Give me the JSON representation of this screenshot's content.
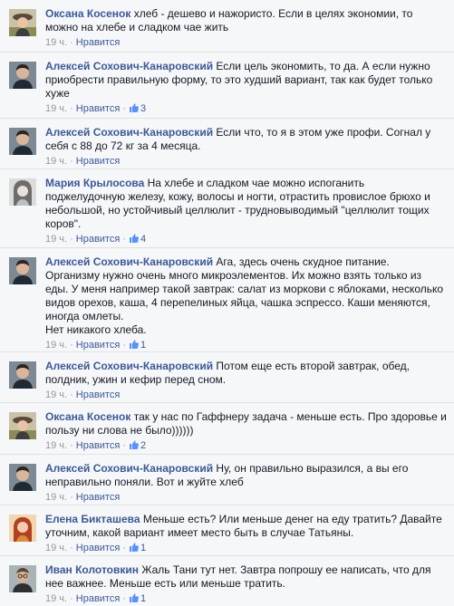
{
  "comments": [
    {
      "author": "Оксана Косенок",
      "avatar": "woman-hat",
      "text": "хлеб - дешево и нажористо. Если в целях экономии, то можно на хлебе и сладком чае жить",
      "time": "19 ч.",
      "like_label": "Нравится",
      "likes": ""
    },
    {
      "author": "Алексей Сохович-Канаровский",
      "avatar": "man-dark",
      "text": "Если цель экономить, то да. А если нужно приобрести правильную форму, то это худший вариант, так как будет только хуже",
      "time": "19 ч.",
      "like_label": "Нравится",
      "likes": "3"
    },
    {
      "author": "Алексей Сохович-Канаровский",
      "avatar": "man-dark",
      "text": "Если что, то я в этом уже профи. Согнал у себя с 88 до 72 кг за 4 месяца.",
      "time": "19 ч.",
      "like_label": "Нравится",
      "likes": ""
    },
    {
      "author": "Мария Крылосова",
      "avatar": "woman-grey",
      "text": "На хлебе и сладком чае можно испоганить поджелудочную железу, кожу, волосы и ногти, отрастить провислое брюхо и небольшой, но устойчивый целлюлит - трудновыводимый \"целлюлит тощих коров\".",
      "time": "19 ч.",
      "like_label": "Нравится",
      "likes": "4"
    },
    {
      "author": "Алексей Сохович-Канаровский",
      "avatar": "man-dark",
      "text": "Ага, здесь очень скудное питание. Организму нужно очень много микроэлементов. Их можно взять только из еды. У меня например такой завтрак: салат из моркови с яблоками, несколько видов орехов, каша, 4 перепелиных яйца, чашка эспрессо. Каши меняются, иногда омлеты.\nНет никакого хлеба.",
      "time": "19 ч.",
      "like_label": "Нравится",
      "likes": "1"
    },
    {
      "author": "Алексей Сохович-Канаровский",
      "avatar": "man-dark",
      "text": "Потом еще есть второй завтрак, обед, полдник, ужин и кефир перед сном.",
      "time": "19 ч.",
      "like_label": "Нравится",
      "likes": ""
    },
    {
      "author": "Оксана Косенок",
      "avatar": "woman-hat",
      "text": "так у нас по Гаффнеру задача - меньше есть. Про здоровье и пользу ни слова не было))))))",
      "time": "19 ч.",
      "like_label": "Нравится",
      "likes": "2"
    },
    {
      "author": "Алексей Сохович-Канаровский",
      "avatar": "man-dark",
      "text": "Ну, он правильно выразился, а вы его неправильно поняли. Вот и жуйте хлеб",
      "time": "19 ч.",
      "like_label": "Нравится",
      "likes": ""
    },
    {
      "author": "Елена Бикташева",
      "avatar": "woman-red",
      "text": "Меньше есть? Или меньше денег на еду тратить? Давайте уточним, какой вариант имеет место быть в случае Татьяны.",
      "time": "19 ч.",
      "like_label": "Нравится",
      "likes": "1"
    },
    {
      "author": "Иван Колотовкин",
      "avatar": "man-glasses",
      "text": "Жаль Тани тут нет. Завтра попрошу ее написать, что для нее важнее. Меньше есть или меньше тратить.",
      "time": "19 ч.",
      "like_label": "Нравится",
      "likes": "1"
    }
  ]
}
